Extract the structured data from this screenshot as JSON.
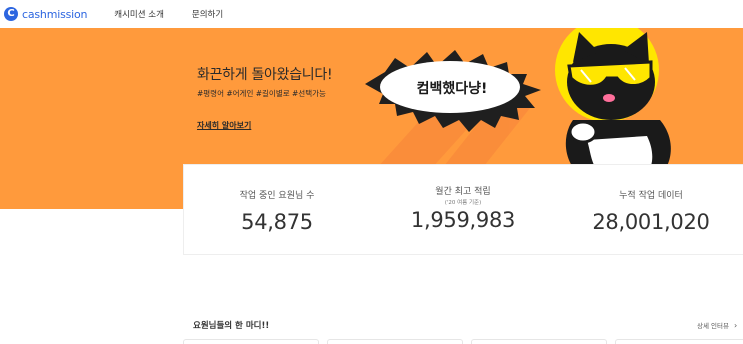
{
  "header": {
    "logo_text": "cashmission",
    "nav": [
      "캐시미션 소개",
      "문의하기"
    ]
  },
  "hero": {
    "title": "화끈하게 돌아왔습니다!",
    "tags": "#평령어 #어게인 #길이별로 #선택가능",
    "link": "자세히 알아보기",
    "bubble_text": "컴백했다냥!",
    "background_color": "#ff9a3c"
  },
  "stats": [
    {
      "label": "작업 중인 요원님 수",
      "sub": "",
      "value": "54,875"
    },
    {
      "label": "월간 최고 적립",
      "sub": "('20 여름 기준)",
      "value": "1,959,983"
    },
    {
      "label": "누적 작업 데이터",
      "sub": "",
      "value": "28,001,020"
    }
  ],
  "reviews": {
    "title": "요원님들의 한 마디!!",
    "more": "상세 인터뷰"
  }
}
